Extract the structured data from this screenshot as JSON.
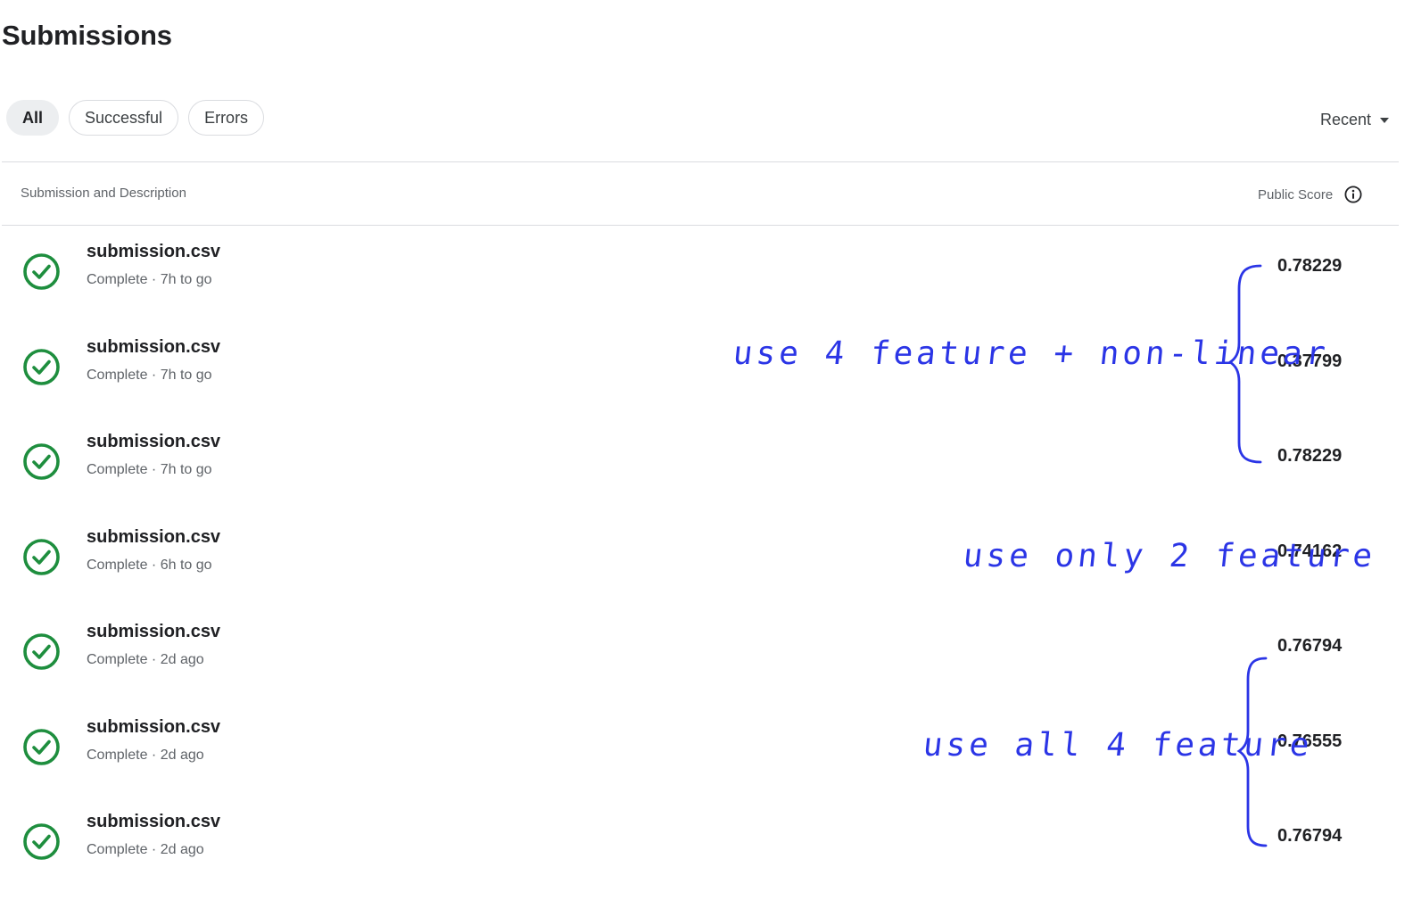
{
  "page": {
    "title": "Submissions"
  },
  "filters": [
    {
      "label": "All",
      "active": true
    },
    {
      "label": "Successful",
      "active": false
    },
    {
      "label": "Errors",
      "active": false
    }
  ],
  "sort": {
    "label": "Recent"
  },
  "table": {
    "columns": [
      "Submission and Description",
      "Public Score"
    ],
    "rows": [
      {
        "name": "submission.csv",
        "status": "Complete · 7h to go",
        "score": "0.78229"
      },
      {
        "name": "submission.csv",
        "status": "Complete · 7h to go",
        "score": "0.37799"
      },
      {
        "name": "submission.csv",
        "status": "Complete · 7h to go",
        "score": "0.78229"
      },
      {
        "name": "submission.csv",
        "status": "Complete · 6h to go",
        "score": "0.74162"
      },
      {
        "name": "submission.csv",
        "status": "Complete · 2d ago",
        "score": "0.76794"
      },
      {
        "name": "submission.csv",
        "status": "Complete · 2d ago",
        "score": "0.76555"
      },
      {
        "name": "submission.csv",
        "status": "Complete · 2d ago",
        "score": "0.76794"
      }
    ]
  },
  "annotations": [
    "use 4 feature + non-linear",
    "use only 2 feature",
    "use all 4 feature"
  ],
  "colors": {
    "success": "#1e8e3e",
    "annotation_ink": "#2b35e6"
  },
  "icons": {
    "status": "check-circle-icon",
    "info": "info-icon"
  }
}
